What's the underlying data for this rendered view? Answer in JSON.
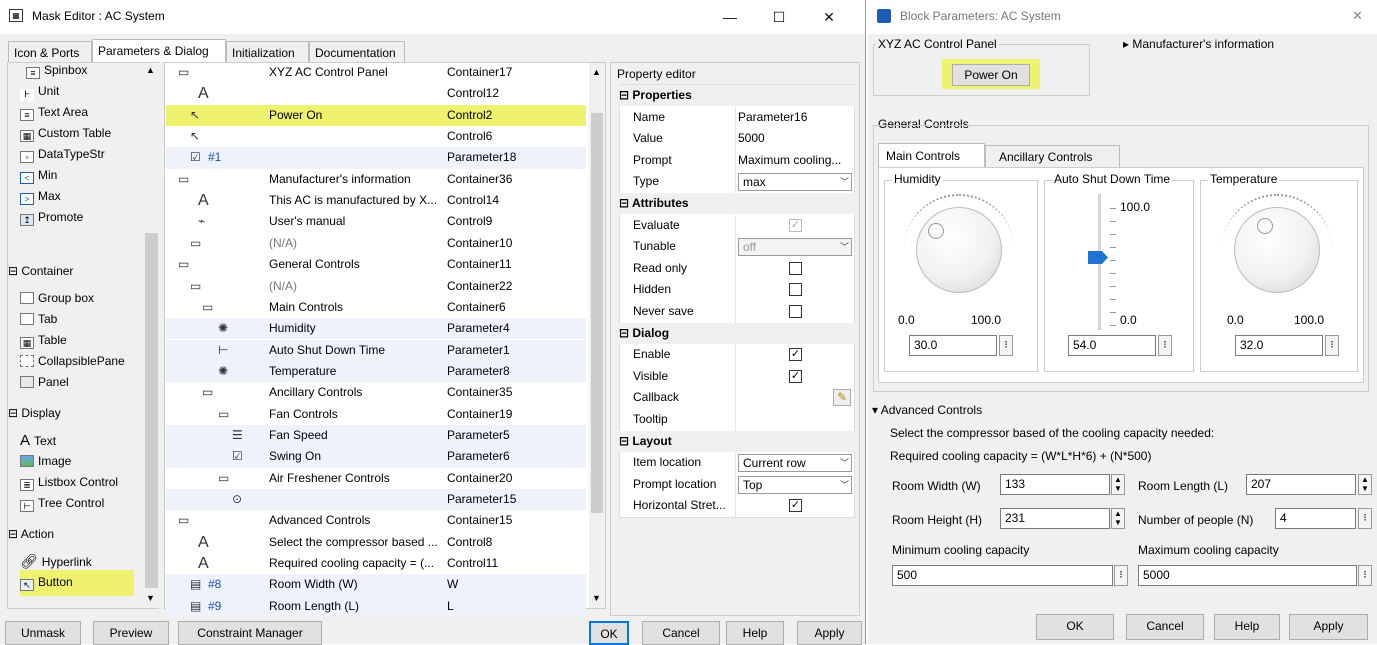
{
  "mask_editor": {
    "title": "Mask Editor : AC System",
    "window_controls": {
      "minimize": "—",
      "maximize": "☐",
      "close": "✕"
    },
    "tabs": [
      "Icon & Ports",
      "Parameters & Dialog",
      "Initialization",
      "Documentation"
    ],
    "active_tab": "Parameters & Dialog",
    "palette": {
      "items_top": [
        "Spinbox",
        "Unit",
        "Text Area",
        "Custom Table",
        "DataTypeStr",
        "Min",
        "Max",
        "Promote"
      ],
      "container_section": "Container",
      "container_items": [
        "Group box",
        "Tab",
        "Table",
        "CollapsiblePane",
        "Panel"
      ],
      "display_section": "Display",
      "display_items": [
        "Text",
        "Image",
        "Listbox Control",
        "Tree Control"
      ],
      "action_section": "Action",
      "action_items": [
        "Hyperlink",
        "Button"
      ]
    },
    "tree_rows": [
      {
        "prompt": "XYZ AC Control Panel",
        "name": "Container17"
      },
      {
        "prompt": "",
        "name": "Control12"
      },
      {
        "prompt": "Power On",
        "name": "Control2"
      },
      {
        "prompt": "",
        "name": "Control6"
      },
      {
        "tag": "#1",
        "prompt": "",
        "name": "Parameter18"
      },
      {
        "prompt": "Manufacturer's information",
        "name": "Container36"
      },
      {
        "prompt": "This AC is manufactured by X...",
        "name": "Control14"
      },
      {
        "prompt": "User's manual",
        "name": "Control9"
      },
      {
        "prompt": "(N/A)",
        "name": "Container10"
      },
      {
        "prompt": "General Controls",
        "name": "Container11"
      },
      {
        "prompt": "(N/A)",
        "name": "Container22"
      },
      {
        "prompt": "Main Controls",
        "name": "Container6"
      },
      {
        "prompt": "Humidity",
        "name": "Parameter4"
      },
      {
        "prompt": "Auto Shut Down Time",
        "name": "Parameter1"
      },
      {
        "prompt": "Temperature",
        "name": "Parameter8"
      },
      {
        "prompt": "Ancillary Controls",
        "name": "Container35"
      },
      {
        "prompt": "Fan Controls",
        "name": "Container19"
      },
      {
        "prompt": "Fan Speed",
        "name": "Parameter5"
      },
      {
        "prompt": "Swing On",
        "name": "Parameter6"
      },
      {
        "prompt": "Air Freshener Controls",
        "name": "Container20"
      },
      {
        "prompt": "",
        "name": "Parameter15"
      },
      {
        "prompt": "Advanced Controls",
        "name": "Container15"
      },
      {
        "prompt": "Select the compressor based ...",
        "name": "Control8"
      },
      {
        "prompt": "Required cooling capacity = (...",
        "name": "Control11"
      },
      {
        "tag": "#8",
        "prompt": "Room Width (W)",
        "name": "W"
      },
      {
        "tag": "#9",
        "prompt": "Room Length (L)",
        "name": "L"
      }
    ],
    "property_editor": {
      "title": "Property editor",
      "groups": {
        "properties": "Properties",
        "attributes": "Attributes",
        "dialog": "Dialog",
        "layout": "Layout"
      },
      "name_label": "Name",
      "name_value": "Parameter16",
      "value_label": "Value",
      "value_value": "5000",
      "prompt_label": "Prompt",
      "prompt_value": "Maximum cooling...",
      "type_label": "Type",
      "type_value": "max",
      "evaluate_label": "Evaluate",
      "tunable_label": "Tunable",
      "tunable_value": "off",
      "readonly_label": "Read only",
      "hidden_label": "Hidden",
      "neversave_label": "Never save",
      "enable_label": "Enable",
      "visible_label": "Visible",
      "callback_label": "Callback",
      "tooltip_label": "Tooltip",
      "itemloc_label": "Item location",
      "itemloc_value": "Current row",
      "promptloc_label": "Prompt location",
      "promptloc_value": "Top",
      "hstretch_label": "Horizontal Stret..."
    },
    "buttons": {
      "unmask": "Unmask",
      "preview": "Preview",
      "constraint": "Constraint Manager",
      "ok": "OK",
      "cancel": "Cancel",
      "help": "Help",
      "apply": "Apply"
    }
  },
  "block_params": {
    "title": "Block Parameters: AC System",
    "close": "✕",
    "control_panel_label": "XYZ AC Control Panel",
    "power_button": "Power On",
    "manufacturer_label": "Manufacturer's information",
    "general_controls": "General Controls",
    "tabs": [
      "Main Controls",
      "Ancillary Controls"
    ],
    "humidity": {
      "label": "Humidity",
      "min": "0.0",
      "max": "100.0",
      "value": "30.0"
    },
    "shutdown": {
      "label": "Auto Shut Down Time",
      "max": "100.0",
      "min": "0.0",
      "value": "54.0"
    },
    "temperature": {
      "label": "Temperature",
      "min": "0.0",
      "max": "100.0",
      "value": "32.0"
    },
    "advanced": {
      "label": "Advanced Controls",
      "line1": "Select the compressor based of the cooling capacity needed:",
      "line2": "Required cooling capacity = (W*L*H*6) + (N*500)",
      "room_width_label": "Room Width (W)",
      "room_width": "133",
      "room_length_label": "Room Length (L)",
      "room_length": "207",
      "room_height_label": "Room Height (H)",
      "room_height": "231",
      "people_label": "Number of people (N)",
      "people": "4",
      "min_cap_label": "Minimum cooling capacity",
      "min_cap": "500",
      "max_cap_label": "Maximum cooling capacity",
      "max_cap": "5000"
    },
    "buttons": {
      "ok": "OK",
      "cancel": "Cancel",
      "help": "Help",
      "apply": "Apply"
    }
  },
  "colors": {
    "highlight_yellow": "#eef26e",
    "accent_blue": "#0078d7"
  }
}
